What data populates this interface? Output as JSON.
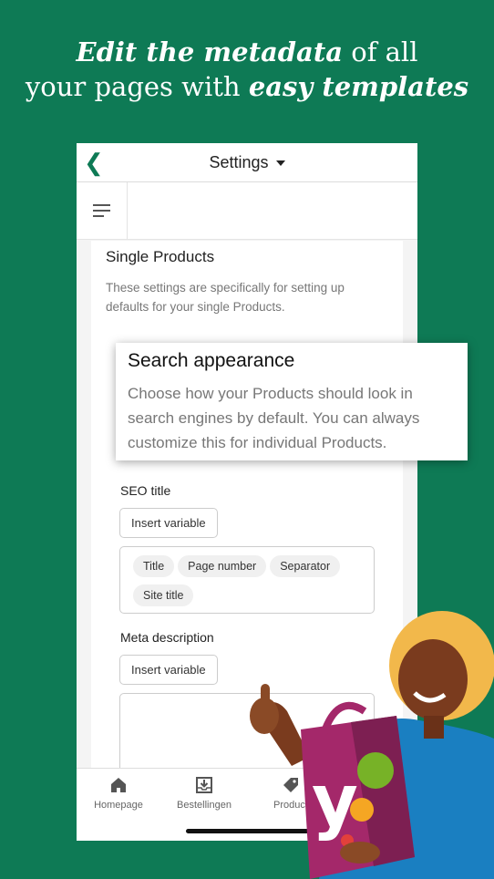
{
  "headline": {
    "part1": "Edit the metadata",
    "part2": " of all",
    "part3": "your pages with ",
    "part4": "easy templates"
  },
  "header": {
    "title": "Settings"
  },
  "section": {
    "title": "Single Products",
    "description": "These settings are specifically for setting up defaults for your single Products."
  },
  "callout": {
    "title": "Search appearance",
    "description": "Choose how your Products should look in search engines by default. You can always customize this for individual Products."
  },
  "seo_title": {
    "label": "SEO title",
    "insert_label": "Insert variable",
    "chips": [
      "Title",
      "Page number",
      "Separator",
      "Site title"
    ]
  },
  "meta_description": {
    "label": "Meta description",
    "insert_label": "Insert variable"
  },
  "tabs": [
    {
      "label": "Homepage",
      "icon": "home-icon"
    },
    {
      "label": "Bestellingen",
      "icon": "inbox-download-icon"
    },
    {
      "label": "Product",
      "icon": "tag-icon"
    }
  ],
  "logo": {
    "text": "y"
  },
  "colors": {
    "background": "#0e7a55",
    "accent": "#0e7a55",
    "bag": "#a4286a"
  }
}
